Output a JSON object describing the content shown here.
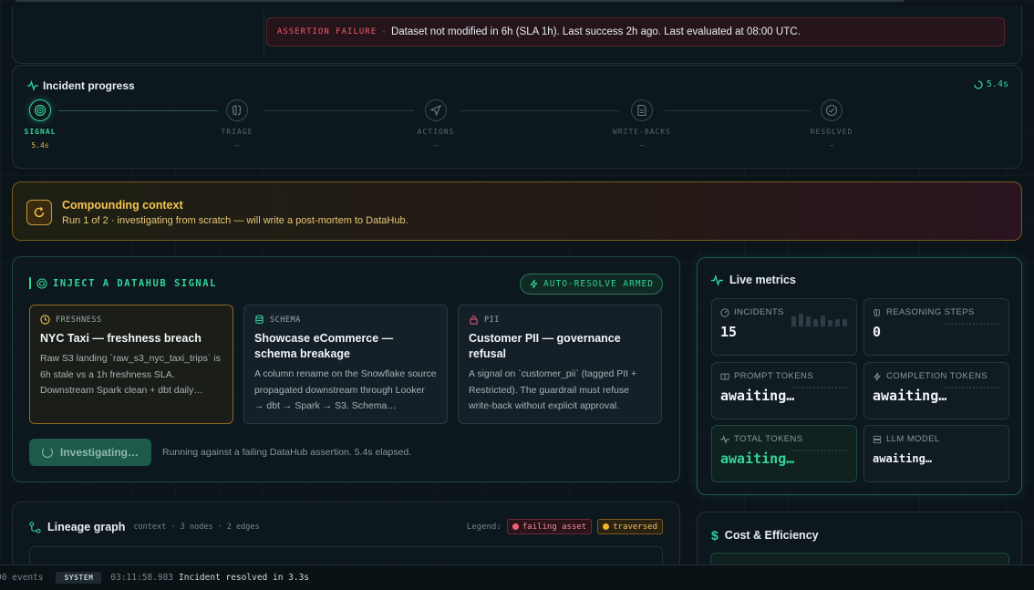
{
  "alert": {
    "tag": "ASSERTION FAILURE",
    "sep": "·",
    "message": "Dataset not modified in 6h (SLA 1h). Last success 2h ago. Last evaluated at 08:00 UTC."
  },
  "progress": {
    "title": "Incident progress",
    "elapsed": "5.4s",
    "steps": [
      {
        "label": "SIGNAL",
        "sub": "5.4s",
        "icon": "radar-icon",
        "active": true
      },
      {
        "label": "TRIAGE",
        "sub": "–",
        "icon": "brain-icon",
        "active": false
      },
      {
        "label": "ACTIONS",
        "sub": "–",
        "icon": "send-icon",
        "active": false
      },
      {
        "label": "WRITE-BACKS",
        "sub": "–",
        "icon": "document-icon",
        "active": false
      },
      {
        "label": "RESOLVED",
        "sub": "–",
        "icon": "check-circle-icon",
        "active": false
      }
    ]
  },
  "compound": {
    "title": "Compounding context",
    "subtitle": "Run 1 of 2 · investigating from scratch — will write a post-mortem to DataHub."
  },
  "inject": {
    "title": "INJECT A DATAHUB SIGNAL",
    "armed": "AUTO-RESOLVE ARMED",
    "signals": [
      {
        "kind": "FRESHNESS",
        "icon": "clock-icon",
        "title": "NYC Taxi — freshness breach",
        "desc": "Raw S3 landing `raw_s3_nyc_taxi_trips` is 6h stale vs a 1h freshness SLA. Downstream Spark clean + dbt daily…",
        "selected": true
      },
      {
        "kind": "SCHEMA",
        "icon": "database-icon",
        "title": "Showcase eCommerce — schema breakage",
        "desc": "A column rename on the Snowflake source propagated downstream through Looker → dbt → Spark → S3. Schema…",
        "selected": false
      },
      {
        "kind": "PII",
        "icon": "lock-icon",
        "title": "Customer PII — governance refusal",
        "desc": "A signal on `customer_pii` (tagged PII + Restricted). The guardrail must refuse write-back without explicit approval.",
        "selected": false
      }
    ],
    "button": "Investigating…",
    "status": "Running against a failing DataHub assertion. 5.4s elapsed."
  },
  "metrics": {
    "title": "Live metrics",
    "tiles": [
      {
        "label": "INCIDENTS",
        "value": "15",
        "icon": "gauge-icon"
      },
      {
        "label": "REASONING STEPS",
        "value": "0",
        "icon": "brain-icon"
      },
      {
        "label": "PROMPT TOKENS",
        "value": "awaiting…",
        "icon": "book-icon"
      },
      {
        "label": "COMPLETION TOKENS",
        "value": "awaiting…",
        "icon": "bolt-icon"
      },
      {
        "label": "TOTAL TOKENS",
        "value": "awaiting…",
        "icon": "pulse-icon"
      },
      {
        "label": "LLM MODEL",
        "value": "awaiting…",
        "icon": "server-icon"
      }
    ],
    "incidents_sparkline": [
      0.8,
      1.0,
      0.75,
      0.55,
      0.85,
      0.5,
      0.55,
      0.6
    ]
  },
  "lineage": {
    "title": "Lineage graph",
    "meta": "context · 3 nodes · 2 edges",
    "legend_label": "Legend:",
    "legend": [
      {
        "label": "failing asset",
        "color": "#f0607a"
      },
      {
        "label": "traversed",
        "color": "#f0b429"
      }
    ]
  },
  "cost": {
    "title": "Cost & Efficiency"
  },
  "footer": {
    "events": "00 events",
    "source": "SYSTEM",
    "time": "03:11:58.983",
    "message": "Incident resolved in 3.3s"
  },
  "colors": {
    "accent": "#34d399",
    "warn": "#f5c451",
    "danger": "#ef5a6f"
  }
}
